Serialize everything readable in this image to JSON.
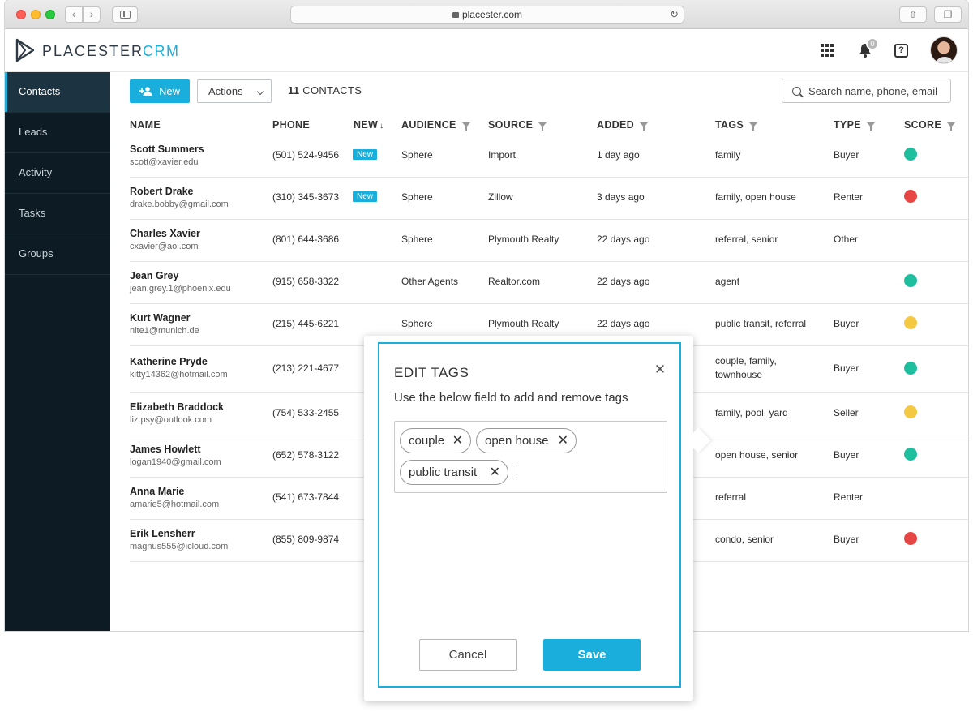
{
  "browser": {
    "url": "placester.com"
  },
  "header": {
    "logo_text": "PLACESTER",
    "logo_product": "CRM",
    "notification_count": "0",
    "help_glyph": "?"
  },
  "sidebar": {
    "items": [
      {
        "label": "Contacts",
        "active": true
      },
      {
        "label": "Leads",
        "active": false
      },
      {
        "label": "Activity",
        "active": false
      },
      {
        "label": "Tasks",
        "active": false
      },
      {
        "label": "Groups",
        "active": false
      }
    ]
  },
  "toolbar": {
    "new_label": "New",
    "actions_label": "Actions",
    "count_number": "11",
    "count_label": "CONTACTS",
    "search_placeholder": "Search name, phone, email"
  },
  "table": {
    "headers": {
      "name": "NAME",
      "phone": "PHONE",
      "new": "NEW",
      "audience": "AUDIENCE",
      "source": "SOURCE",
      "added": "ADDED",
      "tags": "TAGS",
      "type": "TYPE",
      "score": "SCORE"
    },
    "new_badge": "New",
    "rows": [
      {
        "name": "Scott Summers",
        "email": "scott@xavier.edu",
        "phone": "(501) 524-9456",
        "new": true,
        "audience": "Sphere",
        "source": "Import",
        "added": "1 day ago",
        "tags": "family",
        "type": "Buyer",
        "score_color": "#1dbf9e"
      },
      {
        "name": "Robert Drake",
        "email": "drake.bobby@gmail.com",
        "phone": "(310) 345-3673",
        "new": true,
        "audience": "Sphere",
        "source": "Zillow",
        "added": "3 days ago",
        "tags": "family, open house",
        "type": "Renter",
        "score_color": "#e84545"
      },
      {
        "name": "Charles Xavier",
        "email": "cxavier@aol.com",
        "phone": "(801) 644-3686",
        "new": false,
        "audience": "Sphere",
        "source": "Plymouth Realty",
        "added": "22 days ago",
        "tags": "referral, senior",
        "type": "Other",
        "score_color": ""
      },
      {
        "name": "Jean Grey",
        "email": "jean.grey.1@phoenix.edu",
        "phone": "(915) 658-3322",
        "new": false,
        "audience": "Other Agents",
        "source": "Realtor.com",
        "added": "22 days ago",
        "tags": "agent",
        "type": "",
        "score_color": "#1dbf9e"
      },
      {
        "name": "Kurt Wagner",
        "email": "nite1@munich.de",
        "phone": "(215) 445-6221",
        "new": false,
        "audience": "Sphere",
        "source": "Plymouth Realty",
        "added": "22 days ago",
        "tags": "public transit, referral",
        "type": "Buyer",
        "score_color": "#f5c842"
      },
      {
        "name": "Katherine Pryde",
        "email": "kitty14362@hotmail.com",
        "phone": "(213) 221-4677",
        "new": false,
        "audience": "",
        "source": "",
        "added": "",
        "tags": "couple, family, townhouse",
        "type": "Buyer",
        "score_color": "#1dbf9e"
      },
      {
        "name": "Elizabeth Braddock",
        "email": "liz.psy@outlook.com",
        "phone": "(754) 533-2455",
        "new": false,
        "audience": "",
        "source": "",
        "added": "",
        "tags": "family, pool, yard",
        "type": "Seller",
        "score_color": "#f5c842"
      },
      {
        "name": "James Howlett",
        "email": "logan1940@gmail.com",
        "phone": "(652) 578-3122",
        "new": false,
        "audience": "",
        "source": "",
        "added": "",
        "tags": "open house, senior",
        "type": "Buyer",
        "score_color": "#1dbf9e"
      },
      {
        "name": "Anna Marie",
        "email": "amarie5@hotmail.com",
        "phone": "(541) 673-7844",
        "new": false,
        "audience": "",
        "source": "",
        "added": "",
        "tags": "referral",
        "type": "Renter",
        "score_color": ""
      },
      {
        "name": "Erik Lensherr",
        "email": "magnus555@icloud.com",
        "phone": "(855) 809-9874",
        "new": false,
        "audience": "",
        "source": "",
        "added": "",
        "tags": "condo, senior",
        "type": "Buyer",
        "score_color": "#e84545"
      }
    ]
  },
  "modal": {
    "title": "EDIT TAGS",
    "description": "Use the below field to add and remove tags",
    "tags": [
      "couple",
      "open house",
      "public transit"
    ],
    "remove_glyph": "✕",
    "cancel_label": "Cancel",
    "save_label": "Save"
  },
  "colors": {
    "accent": "#1aaedc",
    "sidebar_bg": "#0d1c24",
    "score_green": "#1dbf9e",
    "score_red": "#e84545",
    "score_yellow": "#f5c842"
  }
}
